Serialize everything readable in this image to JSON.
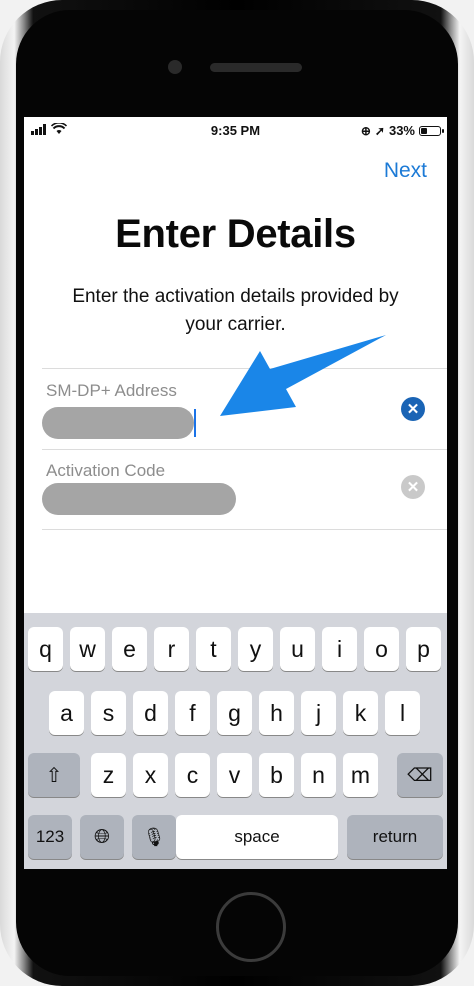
{
  "status": {
    "time": "9:35 PM",
    "battery": "33%",
    "battery_level": 0.33
  },
  "nav": {
    "next_label": "Next"
  },
  "header": {
    "title": "Enter Details",
    "subtitle_line1": "Enter the activation details provided by",
    "subtitle_line2": "your carrier."
  },
  "fields": [
    {
      "label": "SM-DP+ Address",
      "value": ""
    },
    {
      "label": "Activation Code",
      "value": ""
    }
  ],
  "keyboard": {
    "row1": [
      "q",
      "w",
      "e",
      "r",
      "t",
      "y",
      "u",
      "i",
      "o",
      "p"
    ],
    "row2": [
      "a",
      "s",
      "d",
      "f",
      "g",
      "h",
      "j",
      "k",
      "l"
    ],
    "row3": [
      "z",
      "x",
      "c",
      "v",
      "b",
      "n",
      "m"
    ],
    "numbers_label": "123",
    "space_label": "space",
    "return_label": "return"
  },
  "colors": {
    "accent": "#1c7ad6",
    "arrow": "#1a86e8"
  }
}
